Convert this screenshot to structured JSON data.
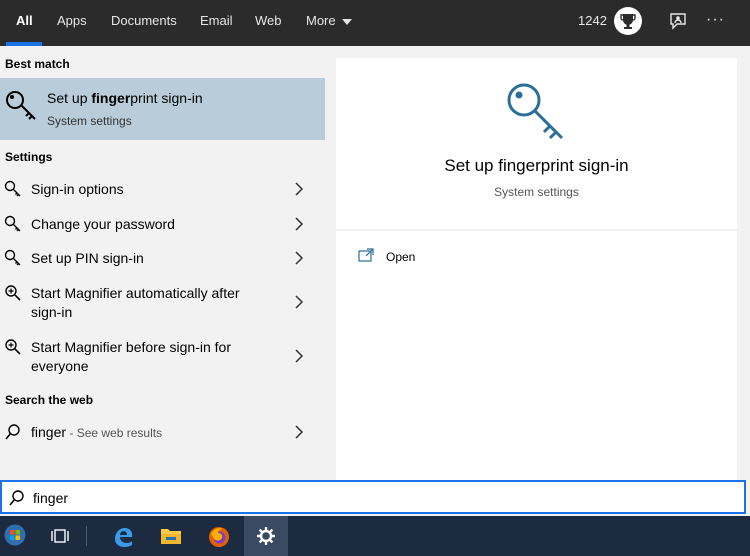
{
  "tabs": [
    {
      "label": "All",
      "active": true
    },
    {
      "label": "Apps"
    },
    {
      "label": "Documents"
    },
    {
      "label": "Email"
    },
    {
      "label": "Web"
    },
    {
      "label": "More"
    }
  ],
  "header": {
    "points": "1242"
  },
  "best_match": {
    "section_title": "Best match",
    "title_prefix": "Set up ",
    "title_bold": "finger",
    "title_suffix": "print sign-in",
    "subtitle": "System settings"
  },
  "settings": {
    "section_title": "Settings",
    "items": [
      {
        "label": "Sign-in options",
        "icon": "key-icon"
      },
      {
        "label": "Change your password",
        "icon": "key-icon"
      },
      {
        "label": "Set up PIN sign-in",
        "icon": "key-icon"
      },
      {
        "label_line1": "Start Magnifier automatically after",
        "label_line2": "sign-in",
        "icon": "magnifier-icon"
      },
      {
        "label_line1": "Start Magnifier before sign-in for",
        "label_line2": "everyone",
        "icon": "magnifier-icon"
      }
    ]
  },
  "web": {
    "section_title": "Search the web",
    "query": "finger",
    "hint": " - See web results"
  },
  "preview": {
    "title": "Set up fingerprint sign-in",
    "subtitle": "System settings",
    "open_label": "Open"
  },
  "search": {
    "value": "finger"
  },
  "colors": {
    "accent": "#1a73e8",
    "best_match_bg": "#b8ccda",
    "topbar": "#2b2b2b",
    "taskbar": "#1c2b40",
    "key_blue": "#2a6f9a"
  }
}
